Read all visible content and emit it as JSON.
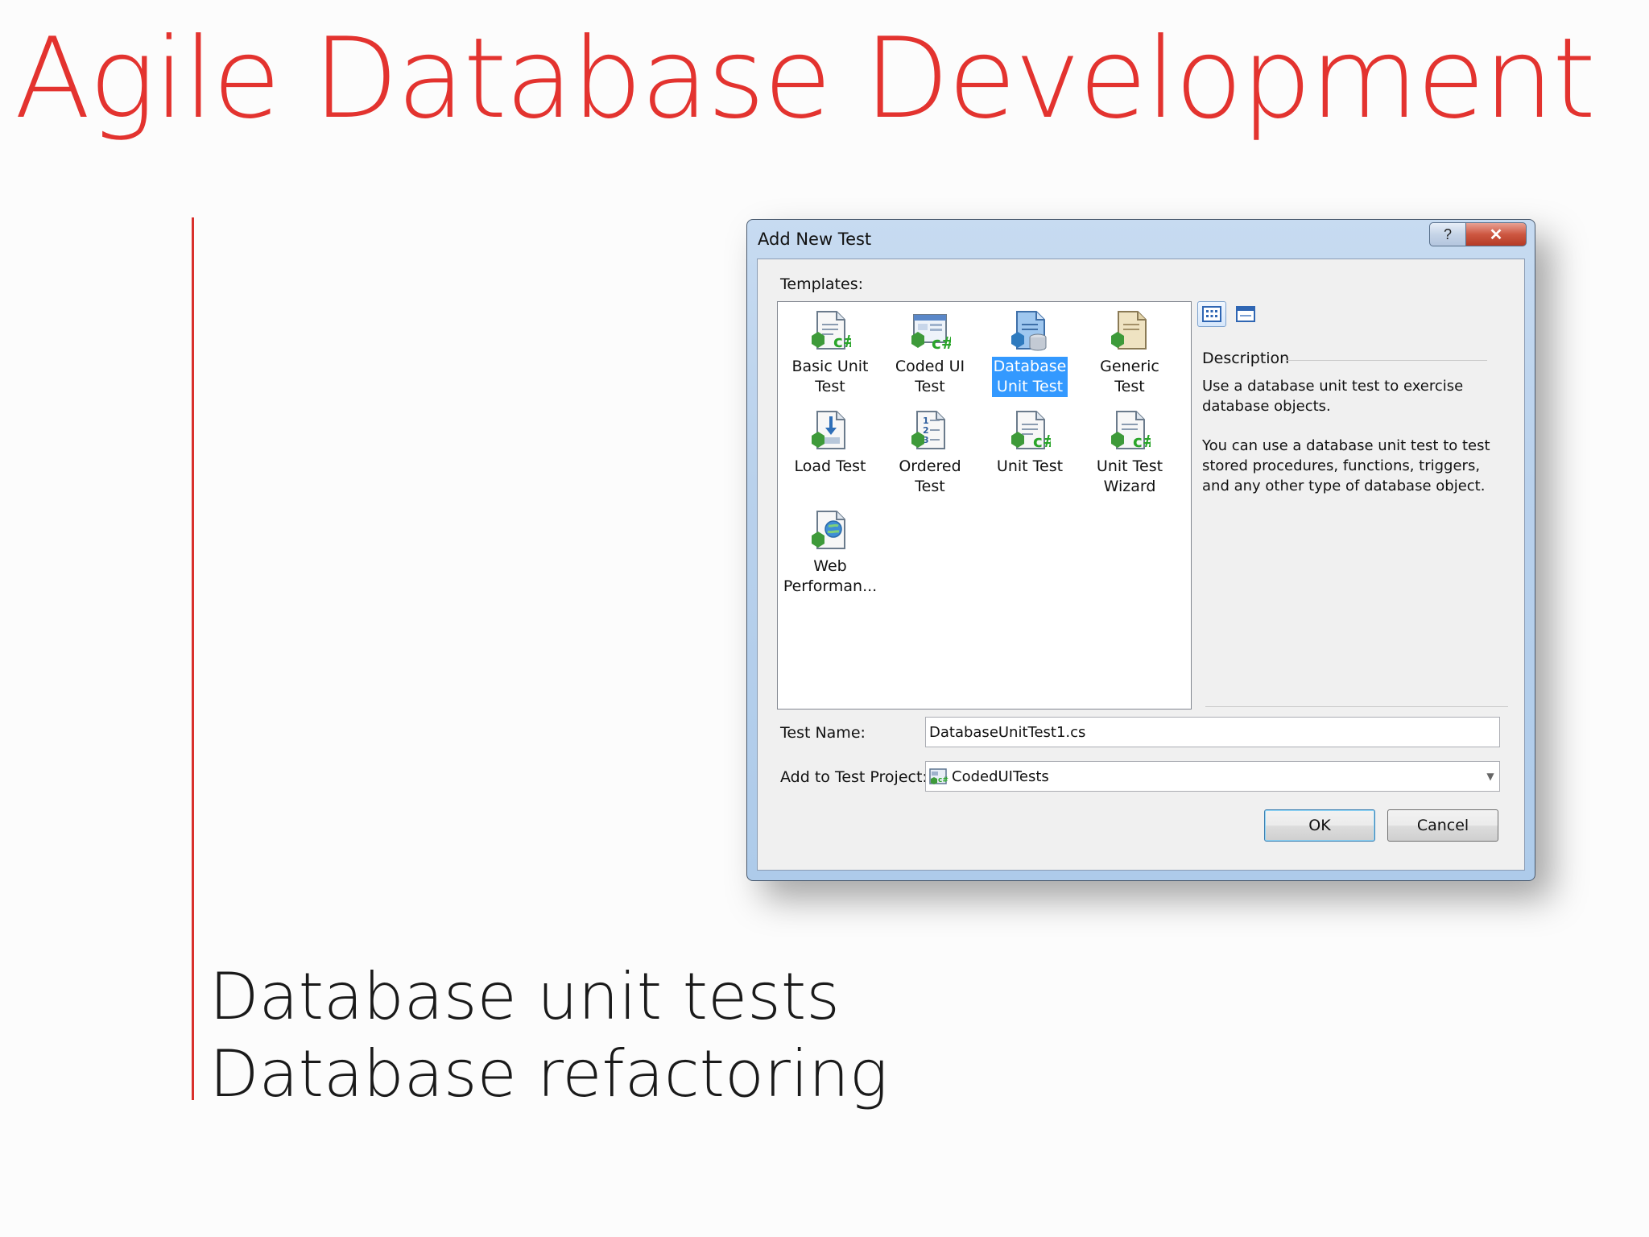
{
  "slide": {
    "title": "Agile Database Development",
    "bullets": [
      "Database unit tests",
      "Database refactoring"
    ]
  },
  "dialog": {
    "title": "Add New Test",
    "help_glyph": "?",
    "close_glyph": "✕",
    "templates_label": "Templates:",
    "templates": [
      {
        "label": "Basic Unit\nTest",
        "icon": "csharp-test-icon"
      },
      {
        "label": "Coded UI\nTest",
        "icon": "coded-ui-test-icon"
      },
      {
        "label": "Database\nUnit Test",
        "icon": "database-test-icon",
        "selected": true
      },
      {
        "label": "Generic Test",
        "icon": "generic-test-icon"
      },
      {
        "label": "Load Test",
        "icon": "load-test-icon"
      },
      {
        "label": "Ordered Test",
        "icon": "ordered-test-icon"
      },
      {
        "label": "Unit Test",
        "icon": "csharp-test-icon"
      },
      {
        "label": "Unit Test\nWizard",
        "icon": "csharp-test-icon"
      },
      {
        "label": "Web\nPerforman...",
        "icon": "web-test-icon"
      }
    ],
    "description_title": "Description",
    "description_paragraphs": [
      "Use a database unit test to exercise database objects.",
      "You can use a database unit test to test stored procedures, functions, triggers, and any other type of database object."
    ],
    "test_name_label": "Test Name:",
    "test_name_value": "DatabaseUnitTest1.cs",
    "project_label": "Add to Test Project:",
    "project_value": "CodedUITests",
    "ok_label": "OK",
    "cancel_label": "Cancel"
  },
  "colors": {
    "title_red": "#e3332f",
    "selection_blue": "#3399ff"
  }
}
